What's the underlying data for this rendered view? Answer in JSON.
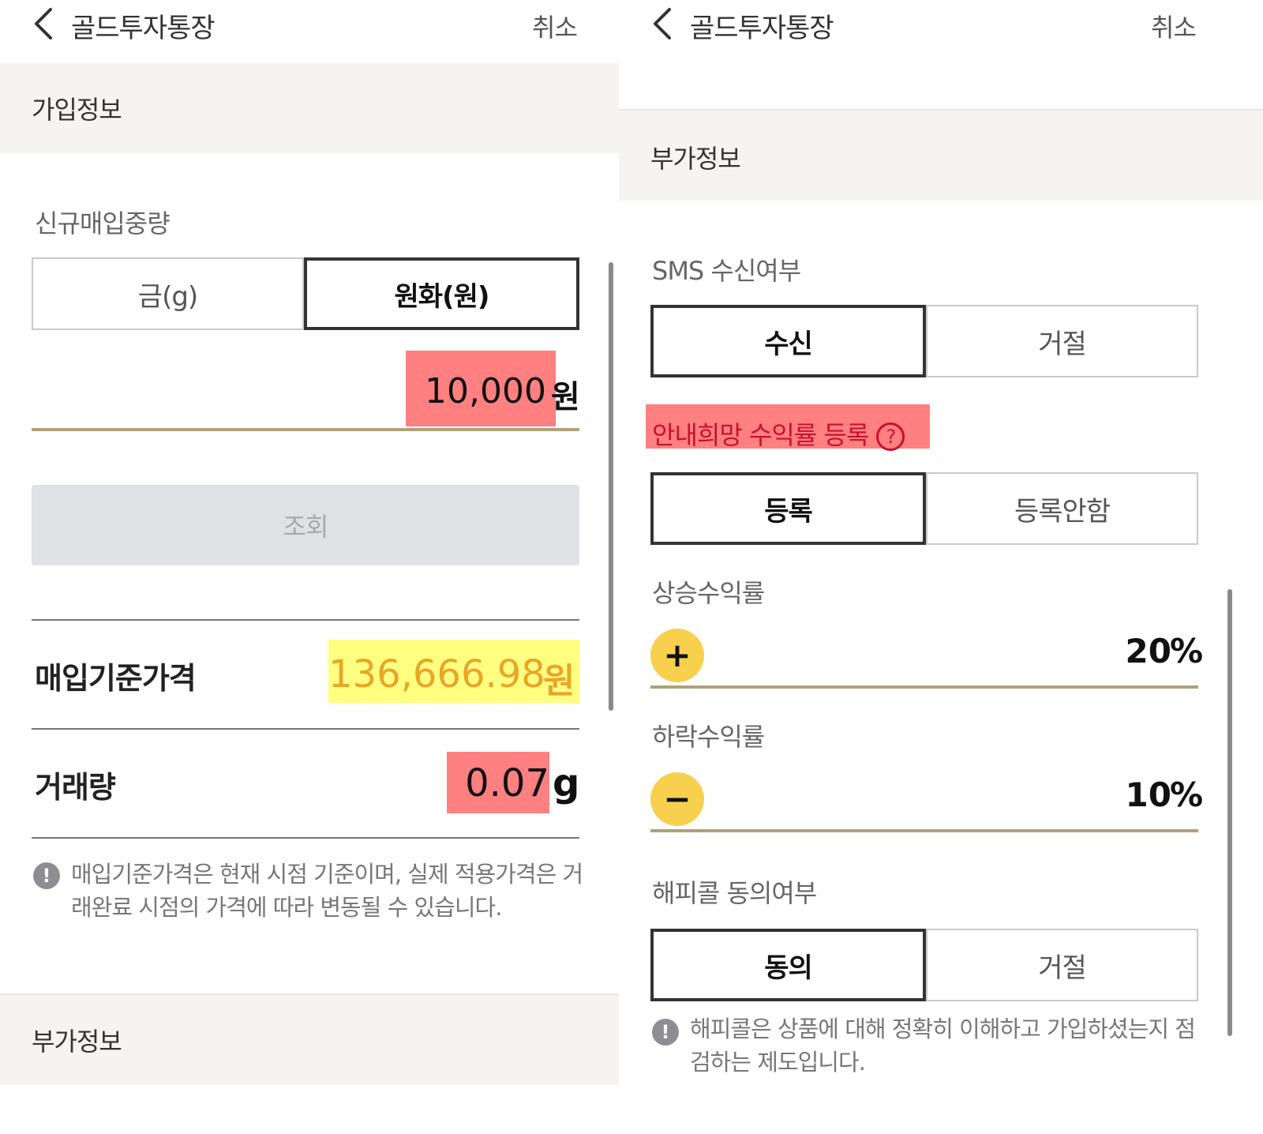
{
  "left": {
    "header": {
      "title": "골드투자통장",
      "cancel": "취소"
    },
    "section_title": "가입정보",
    "weight_label": "신규매입중량",
    "unit_toggle": {
      "options": [
        "금(g)",
        "원화(원)"
      ],
      "selected": 1
    },
    "amount": {
      "value": "10,000",
      "unit": "원"
    },
    "query_button": "조회",
    "price_row": {
      "label": "매입기준가격",
      "value": "136,666.98",
      "unit": "원"
    },
    "volume_row": {
      "label": "거래량",
      "value": "0.07",
      "unit": "g"
    },
    "notice": {
      "line1": "매입기준가격은 현재 시점 기준이며, 실제 적용가격은 거",
      "line2": "래완료 시점의 가격에 따라 변동될 수 있습니다."
    },
    "bottom_section_title": "부가정보"
  },
  "right": {
    "header": {
      "title": "골드투자통장",
      "cancel": "취소"
    },
    "section_title": "부가정보",
    "sms": {
      "label": "SMS 수신여부",
      "options": [
        "수신",
        "거절"
      ],
      "selected": 0
    },
    "target_return": {
      "label": "안내희망 수익률 등록",
      "help": "?",
      "options": [
        "등록",
        "등록안함"
      ],
      "selected": 0
    },
    "rise": {
      "label": "상승수익률",
      "button": "+",
      "value": "20",
      "unit": "%"
    },
    "fall": {
      "label": "하락수익률",
      "button": "−",
      "value": "10",
      "unit": "%"
    },
    "happycall": {
      "label": "해피콜 동의여부",
      "options": [
        "동의",
        "거절"
      ],
      "selected": 0
    },
    "notice": {
      "line1": "해피콜은 상품에 대해 정확히 이해하고 가입하셨는지 점",
      "line2": "검하는 제도입니다."
    }
  },
  "colors": {
    "accent_yellow": "#f7d04e",
    "underline": "#b0a07a",
    "highlight_red": "#ff8080",
    "highlight_yellow": "#ffff80",
    "price_text": "#e8a52a",
    "section_bg": "#f5f4f2"
  }
}
